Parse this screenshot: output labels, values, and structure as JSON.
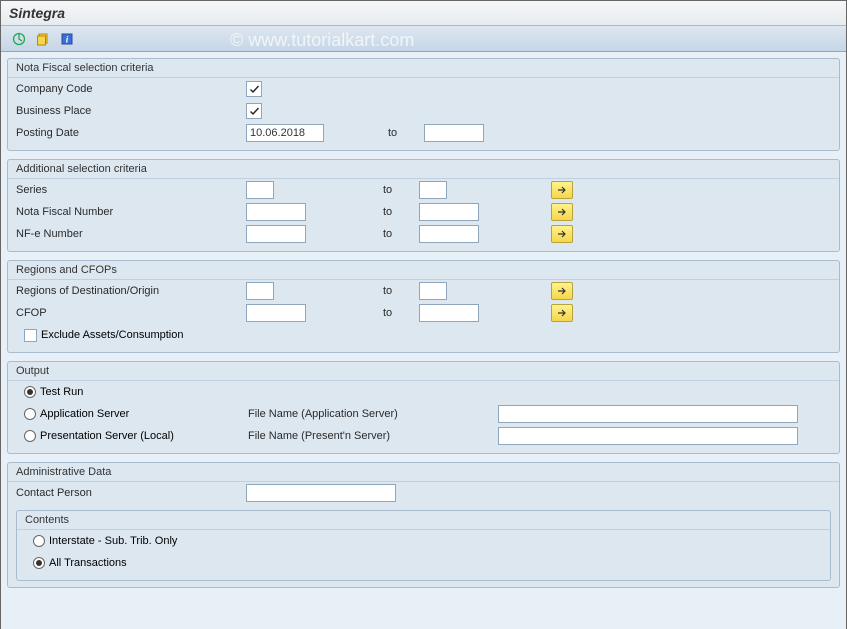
{
  "title": "Sintegra",
  "watermark": "© www.tutorialkart.com",
  "groups": {
    "nf": {
      "title": "Nota Fiscal selection criteria",
      "company_code": "Company Code",
      "business_place": "Business Place",
      "posting_date": "Posting Date",
      "posting_date_val": "10.06.2018",
      "to": "to"
    },
    "add": {
      "title": "Additional selection criteria",
      "series": "Series",
      "nf_number": "Nota Fiscal Number",
      "nfe_number": "NF-e Number",
      "to": "to"
    },
    "reg": {
      "title": "Regions and CFOPs",
      "regions": "Regions of Destination/Origin",
      "cfop": "CFOP",
      "exclude": "Exclude Assets/Consumption",
      "to": "to"
    },
    "out": {
      "title": "Output",
      "test_run": "Test Run",
      "app_server": "Application Server",
      "pres_server": "Presentation Server (Local)",
      "file_app": "File Name (Application Server)",
      "file_pres": "File Name (Present'n Server)"
    },
    "adm": {
      "title": "Administrative Data",
      "contact": "Contact Person",
      "contents": "Contents",
      "interstate": "Interstate - Sub. Trib. Only",
      "all_tx": "All Transactions"
    }
  }
}
